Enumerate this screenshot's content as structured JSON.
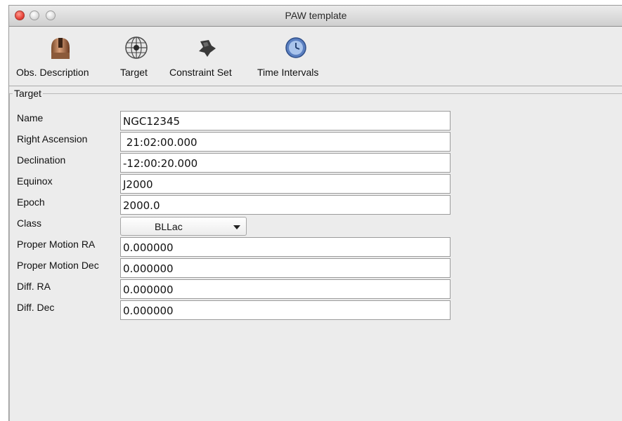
{
  "window": {
    "title": "PAW template"
  },
  "toolbar": {
    "items": [
      {
        "label": "Obs. Description",
        "icon": "observatory-dome-icon"
      },
      {
        "label": "Target",
        "icon": "globe-target-icon"
      },
      {
        "label": "Constraint Set",
        "icon": "pushpin-icon"
      },
      {
        "label": "Time Intervals",
        "icon": "clock-icon"
      }
    ]
  },
  "target_panel": {
    "title": "Target",
    "fields": [
      {
        "label": "Name",
        "value": "NGC12345"
      },
      {
        "label": "Right Ascension",
        "value": " 21:02:00.000"
      },
      {
        "label": "Declination",
        "value": "-12:00:20.000"
      },
      {
        "label": "Equinox",
        "value": "J2000"
      },
      {
        "label": "Epoch",
        "value": "2000.0"
      },
      {
        "label": "Class",
        "value": "BLLac"
      },
      {
        "label": "Proper Motion RA",
        "value": "0.000000"
      },
      {
        "label": "Proper Motion Dec",
        "value": "0.000000"
      },
      {
        "label": "Diff. RA",
        "value": "0.000000"
      },
      {
        "label": "Diff. Dec",
        "value": "0.000000"
      }
    ]
  },
  "colors": {
    "window_bg": "#ececec",
    "field_border": "#9b9b9b",
    "close_red": "#e8443a"
  }
}
